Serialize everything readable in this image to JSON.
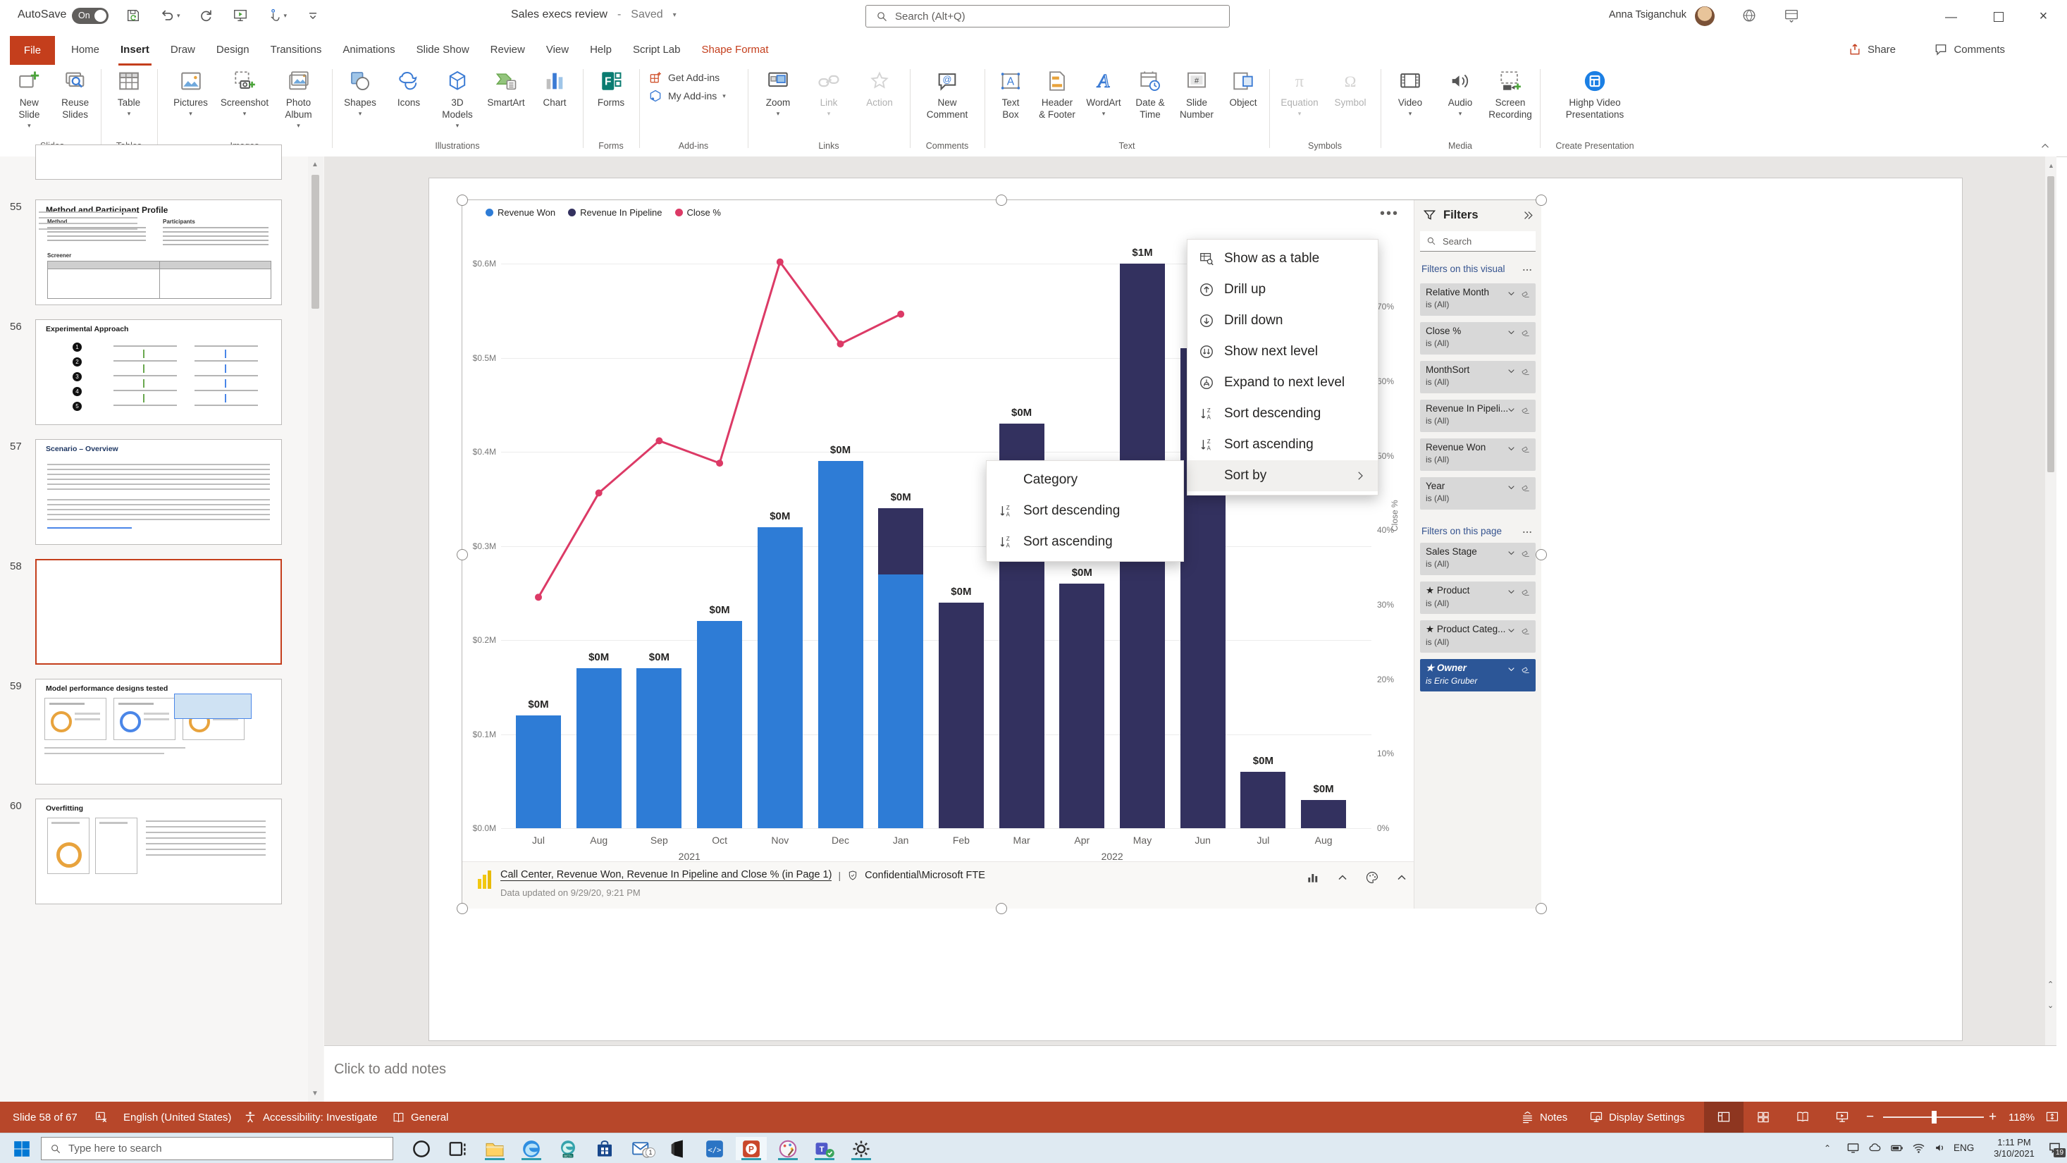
{
  "titlebar": {
    "autosave_label": "AutoSave",
    "autosave_state": "On",
    "qat": [
      "save",
      "undo",
      "redo",
      "start-slideshow",
      "touch-mode",
      "customize-qat"
    ],
    "title": "Sales execs review",
    "title_separator": "-",
    "saved_state": "Saved",
    "search_placeholder": "Search (Alt+Q)",
    "user_name": "Anna Tsiganchuk"
  },
  "ribbon": {
    "share_label": "Share",
    "comments_label": "Comments",
    "tabs": [
      {
        "label": "File",
        "file": true
      },
      {
        "label": "Home"
      },
      {
        "label": "Insert",
        "active": true
      },
      {
        "label": "Draw"
      },
      {
        "label": "Design"
      },
      {
        "label": "Transitions"
      },
      {
        "label": "Animations"
      },
      {
        "label": "Slide Show"
      },
      {
        "label": "Review"
      },
      {
        "label": "View"
      },
      {
        "label": "Help"
      },
      {
        "label": "Script Lab"
      },
      {
        "label": "Shape Format",
        "contextual": true
      }
    ],
    "groups": [
      {
        "label": "Slides",
        "buttons": [
          {
            "label": "New\nSlide",
            "icon": "new-slide",
            "caret": true
          },
          {
            "label": "Reuse\nSlides",
            "icon": "reuse-slides"
          }
        ]
      },
      {
        "label": "Tables",
        "buttons": [
          {
            "label": "Table",
            "icon": "table",
            "caret": true
          }
        ]
      },
      {
        "label": "Images",
        "buttons": [
          {
            "label": "Pictures",
            "icon": "pictures",
            "caret": true
          },
          {
            "label": "Screenshot",
            "icon": "screenshot",
            "caret": true
          },
          {
            "label": "Photo\nAlbum",
            "icon": "photo-album",
            "caret": true
          }
        ]
      },
      {
        "label": "Illustrations",
        "buttons": [
          {
            "label": "Shapes",
            "icon": "shapes",
            "caret": true
          },
          {
            "label": "Icons",
            "icon": "icons"
          },
          {
            "label": "3D\nModels",
            "icon": "3d-models",
            "caret": true
          },
          {
            "label": "SmartArt",
            "icon": "smartart"
          },
          {
            "label": "Chart",
            "icon": "chart"
          }
        ]
      },
      {
        "label": "Forms",
        "buttons": [
          {
            "label": "Forms",
            "icon": "forms"
          }
        ]
      },
      {
        "label": "Add-ins",
        "stacked": true,
        "buttons": [
          {
            "label": "Get Add-ins",
            "icon": "get-addins"
          },
          {
            "label": "My Add-ins",
            "icon": "my-addins",
            "caret": true
          }
        ]
      },
      {
        "label": "Links",
        "buttons": [
          {
            "label": "Zoom",
            "icon": "zoom-screen",
            "caret": true
          },
          {
            "label": "Link",
            "icon": "link",
            "caret": true,
            "disabled": true
          },
          {
            "label": "Action",
            "icon": "action",
            "disabled": true
          }
        ]
      },
      {
        "label": "Comments",
        "buttons": [
          {
            "label": "New\nComment",
            "icon": "new-comment"
          }
        ]
      },
      {
        "label": "Text",
        "buttons": [
          {
            "label": "Text\nBox",
            "icon": "text-box"
          },
          {
            "label": "Header\n& Footer",
            "icon": "header-footer"
          },
          {
            "label": "WordArt",
            "icon": "wordart",
            "caret": true
          },
          {
            "label": "Date &\nTime",
            "icon": "date-time"
          },
          {
            "label": "Slide\nNumber",
            "icon": "slide-number"
          },
          {
            "label": "Object",
            "icon": "object"
          }
        ]
      },
      {
        "label": "Symbols",
        "buttons": [
          {
            "label": "Equation",
            "icon": "equation",
            "caret": true,
            "disabled": true
          },
          {
            "label": "Symbol",
            "icon": "symbol",
            "disabled": true
          }
        ]
      },
      {
        "label": "Media",
        "buttons": [
          {
            "label": "Video",
            "icon": "video",
            "caret": true
          },
          {
            "label": "Audio",
            "icon": "audio",
            "caret": true
          },
          {
            "label": "Screen\nRecording",
            "icon": "screen-recording"
          }
        ]
      },
      {
        "label": "Create Presentation",
        "buttons": [
          {
            "label": "Highp Video\nPresentations",
            "icon": "highp"
          }
        ]
      }
    ]
  },
  "slide_panel": {
    "slides": [
      {
        "number": "55",
        "title": "Method and Participant Profile",
        "kind": "method"
      },
      {
        "number": "56",
        "title": "Experimental Approach",
        "kind": "flow"
      },
      {
        "number": "57",
        "title": "Scenario – Overview",
        "kind": "scenario"
      },
      {
        "number": "58",
        "title": "",
        "kind": "blank",
        "selected": true
      },
      {
        "number": "59",
        "title": "Model performance designs tested",
        "kind": "cards"
      },
      {
        "number": "60",
        "title": "Overfitting",
        "kind": "doc"
      }
    ]
  },
  "notes": {
    "placeholder": "Click to add notes"
  },
  "chart_data": {
    "type": "combo-stacked-column-line",
    "categories": [
      "Jul",
      "Aug",
      "Sep",
      "Oct",
      "Nov",
      "Dec",
      "Jan",
      "Feb",
      "Mar",
      "Apr",
      "May",
      "Jun",
      "Jul",
      "Aug"
    ],
    "year_groups": [
      {
        "label": "2021",
        "from": 0,
        "to": 5
      },
      {
        "label": "2022",
        "from": 6,
        "to": 13
      }
    ],
    "series": [
      {
        "name": "Revenue Won",
        "type": "bar",
        "color": "#2e7cd6",
        "values": [
          0.12,
          0.17,
          0.17,
          0.22,
          0.32,
          0.39,
          0.27,
          0,
          0,
          0,
          0,
          0,
          0,
          0
        ]
      },
      {
        "name": "Revenue In Pipeline",
        "type": "bar",
        "color": "#33315f",
        "values": [
          0,
          0,
          0,
          0,
          0,
          0,
          0.07,
          0.24,
          0.43,
          0.26,
          0.6,
          0.51,
          0.06,
          0.03
        ]
      },
      {
        "name": "Close %",
        "type": "line",
        "color": "#dc3a66",
        "values": [
          31,
          45,
          52,
          49,
          76,
          65,
          69,
          null,
          null,
          null,
          null,
          null,
          null,
          null
        ]
      }
    ],
    "data_labels": [
      "$0M",
      "$0M",
      "$0M",
      "$0M",
      "$0M",
      "$0M",
      "$0M",
      "$0M",
      "$0M",
      "$0M",
      "$1M",
      null,
      "$0M",
      "$0M"
    ],
    "y_axis_left": {
      "ticks": [
        "$0.6M",
        "$0.5M",
        "$0.4M",
        "$0.3M",
        "$0.2M",
        "$0.1M",
        "$0.0M"
      ],
      "max": 0.6
    },
    "y_axis_right": {
      "label": "Close %",
      "ticks": [
        "70%",
        "60%",
        "50%",
        "40%",
        "30%",
        "20%",
        "10%",
        "0%"
      ],
      "max_pct": 70
    },
    "grid": true,
    "legend_position": "top-left"
  },
  "powerbi": {
    "legend": [
      {
        "label": "Revenue Won",
        "color": "#2e7cd6"
      },
      {
        "label": "Revenue In Pipeline",
        "color": "#33315f"
      },
      {
        "label": "Close %",
        "color": "#dc3a66"
      }
    ],
    "context_menu": {
      "items": [
        {
          "icon": "show-table",
          "label": "Show as a table"
        },
        {
          "icon": "drill-up",
          "label": "Drill up"
        },
        {
          "icon": "drill-down",
          "label": "Drill down"
        },
        {
          "icon": "show-next",
          "label": "Show next level"
        },
        {
          "icon": "expand-next",
          "label": "Expand to next level"
        },
        {
          "icon": "sort-za",
          "label": "Sort descending"
        },
        {
          "icon": "sort-za",
          "label": "Sort ascending"
        },
        {
          "icon": "",
          "label": "Sort by",
          "has_submenu": true,
          "highlighted": true
        }
      ]
    },
    "sort_submenu": {
      "items": [
        {
          "icon": "",
          "label": "Category"
        },
        {
          "icon": "sort-za",
          "label": "Sort descending"
        },
        {
          "icon": "sort-za",
          "label": "Sort ascending"
        }
      ]
    },
    "filters": {
      "title": "Filters",
      "search_placeholder": "Search",
      "sections": [
        {
          "title": "Filters on this visual",
          "cards": [
            {
              "name": "Relative Month",
              "value": "is (All)"
            },
            {
              "name": "Close %",
              "value": "is (All)"
            },
            {
              "name": "MonthSort",
              "value": "is (All)"
            },
            {
              "name": "Revenue In Pipeli...",
              "value": "is (All)"
            },
            {
              "name": "Revenue Won",
              "value": "is (All)"
            },
            {
              "name": "Year",
              "value": "is (All)"
            }
          ]
        },
        {
          "title": "Filters on this page",
          "cards": [
            {
              "name": "Sales Stage",
              "value": "is (All)"
            },
            {
              "name": "Product",
              "value": "is (All)",
              "starred": true
            },
            {
              "name": "Product Categ...",
              "value": "is (All)",
              "starred": true
            },
            {
              "name": "Owner",
              "value": "is Eric Gruber",
              "starred": true,
              "active": true
            }
          ]
        }
      ]
    },
    "footer": {
      "link_text": "Call Center, Revenue Won, Revenue In Pipeline and Close % (in Page 1)",
      "separator": "|",
      "sensitivity": "Confidential\\Microsoft FTE",
      "updated_text": "Data updated on 9/29/20, 9:21 PM"
    }
  },
  "status_bar": {
    "slide_label": "Slide 58 of 67",
    "language": "English (United States)",
    "accessibility": "Accessibility: Investigate",
    "macro": "General",
    "notes_label": "Notes",
    "display_settings_label": "Display Settings",
    "zoom_level": "118%"
  },
  "taskbar": {
    "search_placeholder": "Type here to search",
    "apps": [
      {
        "name": "cortana"
      },
      {
        "name": "task-view"
      },
      {
        "name": "file-explorer",
        "running": true
      },
      {
        "name": "edge",
        "running": true
      },
      {
        "name": "edge-beta"
      },
      {
        "name": "store"
      },
      {
        "name": "mail",
        "badge": "1"
      },
      {
        "name": "office"
      },
      {
        "name": "vs-code"
      },
      {
        "name": "powerpoint",
        "running": true,
        "active": true
      },
      {
        "name": "paint",
        "running": true
      },
      {
        "name": "teams",
        "running": true
      },
      {
        "name": "settings",
        "running": true
      }
    ],
    "tray": {
      "language": "ENG",
      "time": "1:11 PM",
      "date": "3/10/2021",
      "notification_count": "19"
    }
  },
  "colors": {
    "brand_red": "#c43e1c",
    "status_red": "#b7472a",
    "filter_active": "#2c5697",
    "taskbar_bg": "#dfeaf2"
  }
}
